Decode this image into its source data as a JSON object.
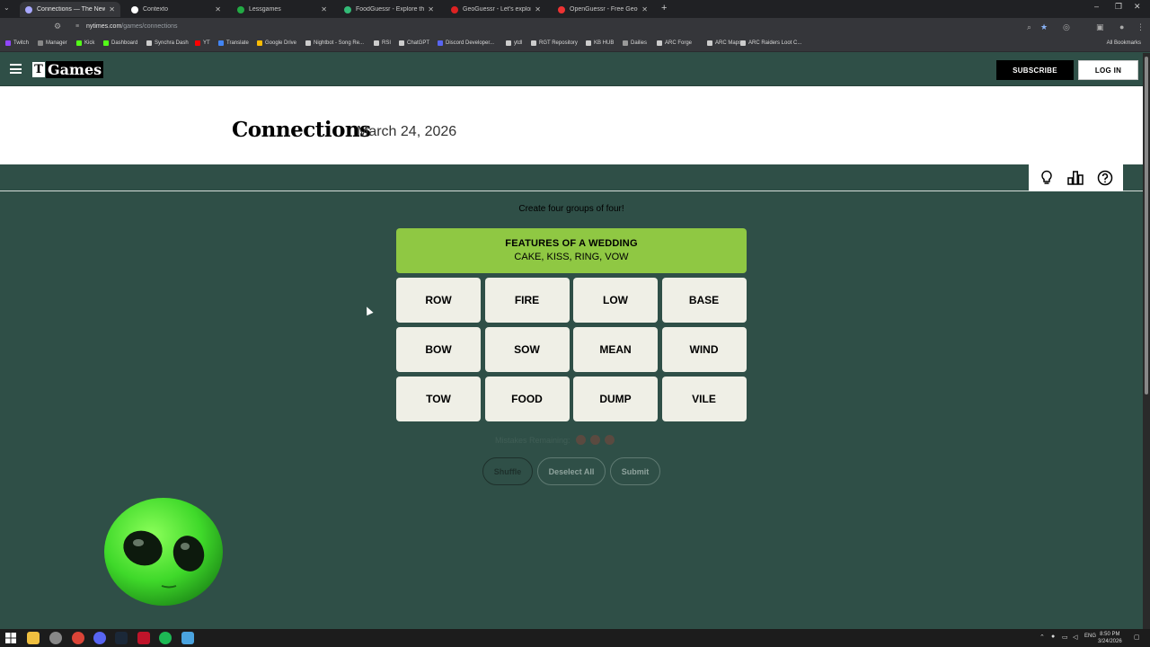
{
  "browser": {
    "tabs": [
      {
        "title": "Connections — The New York T",
        "active": true,
        "color": "#a8a8ff"
      },
      {
        "title": "Contexto",
        "active": false,
        "color": "#ffffff"
      },
      {
        "title": "Lessgames",
        "active": false,
        "color": "#22aa44"
      },
      {
        "title": "FoodGuessr - Explore the world",
        "active": false,
        "color": "#33bb77"
      },
      {
        "title": "GeoGuessr - Let's explore the w",
        "active": false,
        "color": "#dd2222"
      },
      {
        "title": "OpenGuessr - Free GeoGuessr",
        "active": false,
        "color": "#ee3333"
      }
    ],
    "new_tab": "+",
    "url_host": "nytimes.com",
    "url_path": "/games/connections",
    "bookmarks": [
      {
        "label": "Twitch",
        "color": "#9146ff"
      },
      {
        "label": "Manager",
        "color": "#888888"
      },
      {
        "label": "Kick",
        "color": "#53fc18"
      },
      {
        "label": "Dashboard",
        "color": "#53fc18"
      },
      {
        "label": "Synchra Dash",
        "color": "#cccccc"
      },
      {
        "label": "YT",
        "color": "#ff0000"
      },
      {
        "label": "Translate",
        "color": "#4285f4"
      },
      {
        "label": "Google Drive",
        "color": "#fbbc04"
      },
      {
        "label": "Nightbot - Song Re...",
        "color": "#cccccc"
      },
      {
        "label": "RSI",
        "color": "#cccccc"
      },
      {
        "label": "ChatGPT",
        "color": "#cccccc"
      },
      {
        "label": "Discord Developer...",
        "color": "#5865f2"
      },
      {
        "label": "ytdl",
        "color": "#cccccc"
      },
      {
        "label": "RGT Repository",
        "color": "#cccccc"
      },
      {
        "label": "KB HUB",
        "color": "#cccccc"
      },
      {
        "label": "Dailies",
        "color": "#999999"
      },
      {
        "label": "ARC Forge",
        "color": "#cccccc"
      },
      {
        "label": "ARC Maps",
        "color": "#cccccc"
      },
      {
        "label": "ARC Raiders Loot C...",
        "color": "#cccccc"
      }
    ],
    "all_bookmarks": "All Bookmarks"
  },
  "header": {
    "logo_text": "Games",
    "subscribe": "SUBSCRIBE",
    "login": "LOG IN"
  },
  "game": {
    "title": "Connections",
    "date": "March 24, 2026",
    "instruction": "Create four groups of four!",
    "solved": [
      {
        "category": "FEATURES OF A WEDDING",
        "words": "CAKE, KISS, RING, VOW",
        "color": "#8fc843"
      }
    ],
    "tiles": [
      "ROW",
      "FIRE",
      "LOW",
      "BASE",
      "BOW",
      "SOW",
      "MEAN",
      "WIND",
      "TOW",
      "FOOD",
      "DUMP",
      "VILE"
    ],
    "mistakes_label": "Mistakes Remaining:",
    "mistakes_remaining": 3,
    "buttons": {
      "shuffle": "Shuffle",
      "deselect": "Deselect All",
      "submit": "Submit"
    }
  },
  "taskbar": {
    "lang": "ENG",
    "time": "8:50 PM",
    "date": "3/24/2026"
  }
}
